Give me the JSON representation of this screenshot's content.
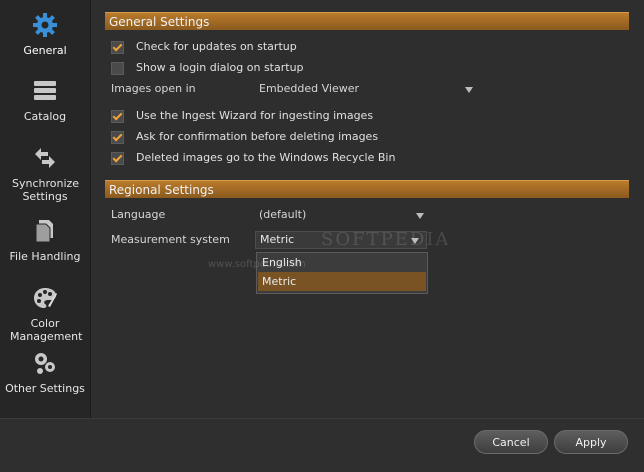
{
  "sidebar": {
    "items": [
      {
        "label": "General",
        "icon": "gear-icon",
        "active": true
      },
      {
        "label": "Catalog",
        "icon": "catalog-icon"
      },
      {
        "label": "Synchronize Settings",
        "icon": "synchronize-icon"
      },
      {
        "label": "File Handling",
        "icon": "file-handling-icon"
      },
      {
        "label": "Color Management",
        "icon": "palette-icon"
      },
      {
        "label": "Other Settings",
        "icon": "gears-icon"
      }
    ]
  },
  "general": {
    "header": "General Settings",
    "check_updates": {
      "label": "Check for updates on startup",
      "checked": true
    },
    "login_dialog": {
      "label": "Show a login dialog on startup",
      "checked": false
    },
    "images_open_in": {
      "label": "Images open in",
      "value": "Embedded Viewer"
    },
    "ingest_wizard": {
      "label": "Use the Ingest Wizard for ingesting images",
      "checked": true
    },
    "confirm_delete": {
      "label": "Ask for confirmation before deleting images",
      "checked": true
    },
    "recycle_bin": {
      "label": "Deleted images go to the Windows Recycle Bin",
      "checked": true
    }
  },
  "regional": {
    "header": "Regional Settings",
    "language": {
      "label": "Language",
      "value": "(default)"
    },
    "measurement": {
      "label": "Measurement system",
      "value": "Metric",
      "options": [
        "English",
        "Metric"
      ],
      "highlighted": "Metric"
    }
  },
  "watermark": {
    "brand": "SOFTPEDIA",
    "url": "www.softpedia.com"
  },
  "footer": {
    "cancel": "Cancel",
    "apply": "Apply"
  },
  "colors": {
    "accent": "#ba7b2c",
    "icon_blue": "#3a8fd9",
    "background": "#2b2b2b"
  }
}
